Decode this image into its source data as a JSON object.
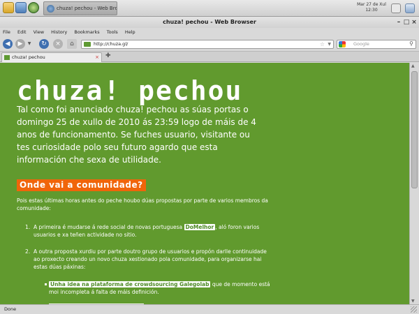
{
  "taskbar": {
    "task_title": "chuza! pechou - Web Bro...",
    "clock_date": "Mar 27 de Xul",
    "clock_time": "12:30"
  },
  "window": {
    "title": "chuza! pechou - Web Browser"
  },
  "menu": {
    "items": [
      "File",
      "Edit",
      "View",
      "History",
      "Bookmarks",
      "Tools",
      "Help"
    ]
  },
  "navigation": {
    "url": "http://chuza.gl/",
    "search_placeholder": "Google"
  },
  "tab": {
    "label": "chuza! pechou"
  },
  "page": {
    "heading": "chuza! pechou",
    "lead": "Tal como foi anunciado chuza! pechou as súas portas o domingo 25 de xullo de 2010 ás 23:59 logo de máis de 4 anos de funcionamento. Se fuches usuario, visitante ou tes curiosidade polo seu futuro agardo que esta información che sexa de utilidade.",
    "subheading": "Onde vai a comunidade?",
    "intro": "Pois estas últimas horas antes do peche houbo dúas propostas por parte de varios membros da comunidade:",
    "list": [
      {
        "num": "1.",
        "before": "A primeira é mudarse á rede social de novas portuguesa ",
        "link": "DoMelhor",
        "after": ", aló foron varios usuarios e xa teñen actividade no sitio."
      },
      {
        "num": "2.",
        "text": "A outra proposta xurdiu por parte doutro grupo de usuarios e propón darlle continuidade ao proxecto creando un novo chuza xestionado pola comunidade, para organizarse hai estas dúas páxinas:"
      }
    ],
    "sublist": [
      {
        "link": "Unha idea na plataforma de crowdsourcing Galegolab",
        "after": " que de momento está moi incompleta á falta de máis definición."
      }
    ]
  },
  "status": {
    "text": "Done"
  },
  "colors": {
    "page_bg": "#619a2e",
    "accent": "#f0650a"
  }
}
